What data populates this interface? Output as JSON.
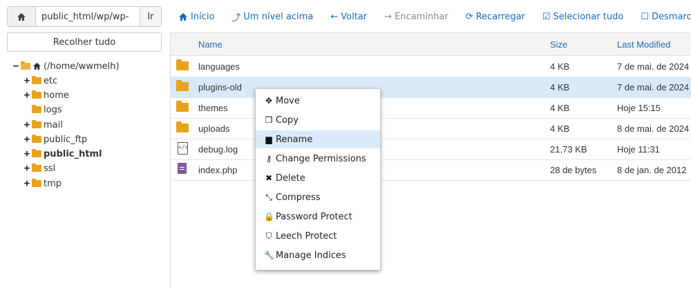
{
  "left": {
    "path_value": "public_html/wp/wp-",
    "go_label": "Ir",
    "collapse_label": "Recolher tudo",
    "tree": {
      "root_label": "(/home/wwmelh)",
      "root_expander": "−",
      "children": [
        {
          "label": "etc",
          "expander": "+"
        },
        {
          "label": "home",
          "expander": "+"
        },
        {
          "label": "logs",
          "expander": ""
        },
        {
          "label": "mail",
          "expander": "+"
        },
        {
          "label": "public_ftp",
          "expander": "+"
        },
        {
          "label": "public_html",
          "expander": "+",
          "bold": true
        },
        {
          "label": "ssl",
          "expander": "+"
        },
        {
          "label": "tmp",
          "expander": "+"
        }
      ]
    }
  },
  "toolbar": {
    "home": "Início",
    "up": "Um nível acima",
    "back": "Voltar",
    "forward": "Encaminhar",
    "reload": "Recarregar",
    "select_all": "Selecionar tudo",
    "deselect": "Desmarcar"
  },
  "table": {
    "headers": {
      "name": "Name",
      "size": "Size",
      "modified": "Last Modified"
    },
    "rows": [
      {
        "name": "languages",
        "size": "4 KB",
        "modified": "7 de mai. de 2024",
        "type": "folder"
      },
      {
        "name": "plugins-old",
        "size": "4 KB",
        "modified": "7 de mai. de 2024",
        "type": "folder",
        "selected": true
      },
      {
        "name": "themes",
        "size": "4 KB",
        "modified": "Hoje 15:15",
        "type": "folder"
      },
      {
        "name": "uploads",
        "size": "4 KB",
        "modified": "8 de mai. de 2024",
        "type": "folder"
      },
      {
        "name": "debug.log",
        "size": "21,73 KB",
        "modified": "Hoje 11:31",
        "type": "code-file"
      },
      {
        "name": "index.php",
        "size": "28 de bytes",
        "modified": "8 de jan. de 2012",
        "type": "text-file"
      }
    ]
  },
  "context_menu": {
    "items": [
      {
        "label": "Move",
        "icon": "move-icon",
        "glyph": "✥"
      },
      {
        "label": "Copy",
        "icon": "copy-icon",
        "glyph": "❐"
      },
      {
        "label": "Rename",
        "icon": "file-icon",
        "glyph": "▆",
        "highlighted": true
      },
      {
        "label": "Change Permissions",
        "icon": "key-icon",
        "glyph": "⚷"
      },
      {
        "label": "Delete",
        "icon": "x-icon",
        "glyph": "✖"
      },
      {
        "label": "Compress",
        "icon": "compress-icon",
        "glyph": "⤡"
      },
      {
        "label": "Password Protect",
        "icon": "lock-icon",
        "glyph": "🔒"
      },
      {
        "label": "Leech Protect",
        "icon": "shield-icon",
        "glyph": "⛉"
      },
      {
        "label": "Manage Indices",
        "icon": "wrench-icon",
        "glyph": "🔧"
      }
    ]
  },
  "colors": {
    "link": "#1b69b8",
    "folder": "#e8a31c",
    "selection": "#d9e9f7"
  }
}
